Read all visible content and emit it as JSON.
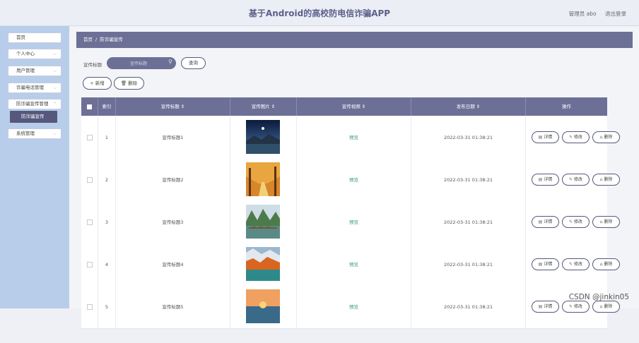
{
  "app": {
    "title": "基于Android的高校防电信诈骗APP",
    "user": "管理员 abo",
    "logout": "退出登录"
  },
  "sidebar": {
    "items": [
      {
        "label": "首页",
        "has_chevron": false
      },
      {
        "label": "个人中心",
        "has_chevron": true
      },
      {
        "label": "用户管理",
        "has_chevron": true
      },
      {
        "label": "诈骗电话管理",
        "has_chevron": true
      },
      {
        "label": "防诈骗宣传管理",
        "has_chevron": true
      },
      {
        "label": "系统管理",
        "has_chevron": true
      }
    ],
    "active_sub": "防诈骗宣传"
  },
  "breadcrumb": {
    "home": "首页",
    "separator": "/",
    "current": "防诈骗宣传"
  },
  "search": {
    "label": "宣传标题",
    "placeholder": "宣传标题",
    "value": "",
    "query_button": "查询"
  },
  "actions": {
    "add": "+ 新增",
    "delete": "删除"
  },
  "table": {
    "headers": [
      "索引",
      "宣传标题 ⇕",
      "宣传图片 ⇕",
      "宣传视频 ⇕",
      "发布日期 ⇕",
      "操作"
    ],
    "rows": [
      {
        "index": "1",
        "title": "宣传标题1",
        "video": "预览",
        "date": "2022-03-31 01:38:21",
        "image": "night-lake"
      },
      {
        "index": "2",
        "title": "宣传标题2",
        "video": "预览",
        "date": "2022-03-31 01:38:21",
        "image": "autumn-path"
      },
      {
        "index": "3",
        "title": "宣传标题3",
        "video": "预览",
        "date": "2022-03-31 01:38:21",
        "image": "karst-bridge"
      },
      {
        "index": "4",
        "title": "宣传标题4",
        "video": "预览",
        "date": "2022-03-31 01:38:21",
        "image": "autumn-lake"
      },
      {
        "index": "5",
        "title": "宣传标题5",
        "video": "预览",
        "date": "2022-03-31 01:38:21",
        "image": "sunset-coast"
      }
    ],
    "row_actions": {
      "detail": "详情",
      "edit": "修改",
      "delete": "删除"
    }
  },
  "watermark": "CSDN @jinkin05",
  "colors": {
    "primary": "#6d7096",
    "dark": "#55587c",
    "sidebar_bg": "#b8cdea",
    "link_green": "#3f9b6a"
  }
}
